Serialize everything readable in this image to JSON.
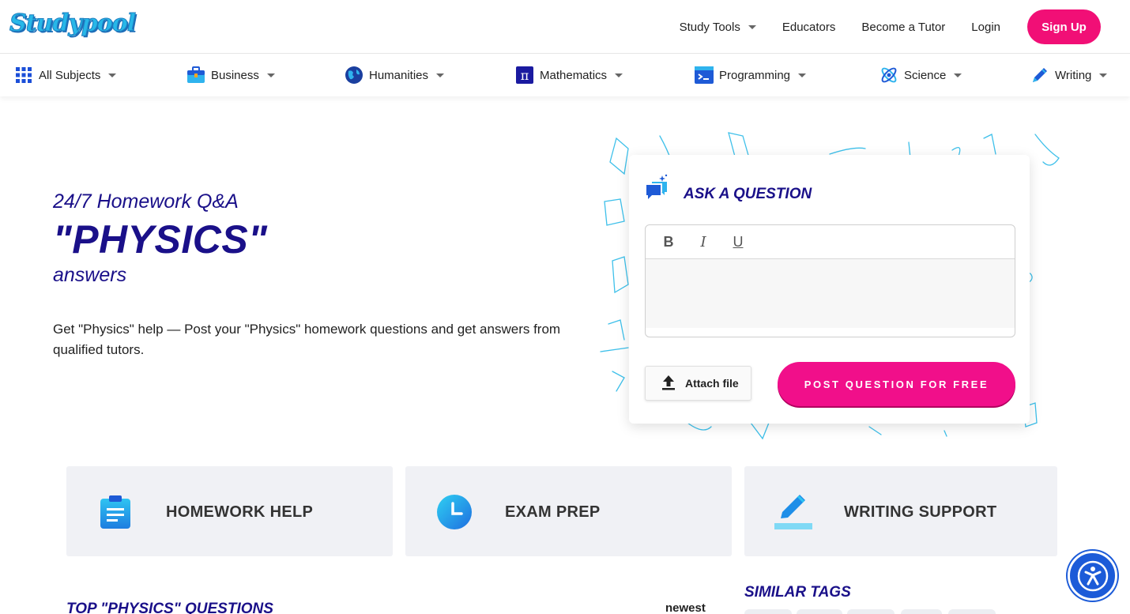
{
  "brand": {
    "logo_text": "Studypool"
  },
  "topnav": {
    "study_tools": "Study Tools",
    "educators": "Educators",
    "become_tutor": "Become a Tutor",
    "login": "Login",
    "signup": "Sign Up"
  },
  "subjects": [
    {
      "label": "All Subjects",
      "icon": "grid-icon"
    },
    {
      "label": "Business",
      "icon": "briefcase-icon"
    },
    {
      "label": "Humanities",
      "icon": "globe-icon"
    },
    {
      "label": "Mathematics",
      "icon": "pi-icon"
    },
    {
      "label": "Programming",
      "icon": "terminal-icon"
    },
    {
      "label": "Science",
      "icon": "atom-icon"
    },
    {
      "label": "Writing",
      "icon": "pen-icon"
    }
  ],
  "hero": {
    "subtitle": "24/7 Homework Q&A",
    "title": "\"PHYSICS\"",
    "answers": "answers",
    "description": "Get \"Physics\" help — Post your \"Physics\" homework questions and get answers from qualified tutors."
  },
  "ask": {
    "title": "ASK A QUESTION",
    "bold": "B",
    "italic": "I",
    "underline": "U",
    "attach": "Attach file",
    "post": "POST QUESTION FOR FREE"
  },
  "services": [
    {
      "label": "HOMEWORK HELP",
      "icon": "clipboard-icon"
    },
    {
      "label": "EXAM PREP",
      "icon": "clock-icon"
    },
    {
      "label": "WRITING SUPPORT",
      "icon": "pencil-icon"
    }
  ],
  "bottom": {
    "top_questions": "TOP \"PHYSICS\" QUESTIONS",
    "sort": "newest",
    "similar_tags": "SIMILAR TAGS"
  },
  "colors": {
    "brand_blue": "#27b7e8",
    "navy": "#1a1089",
    "pink": "#f10f76",
    "card_bg": "#f0f1f5"
  }
}
